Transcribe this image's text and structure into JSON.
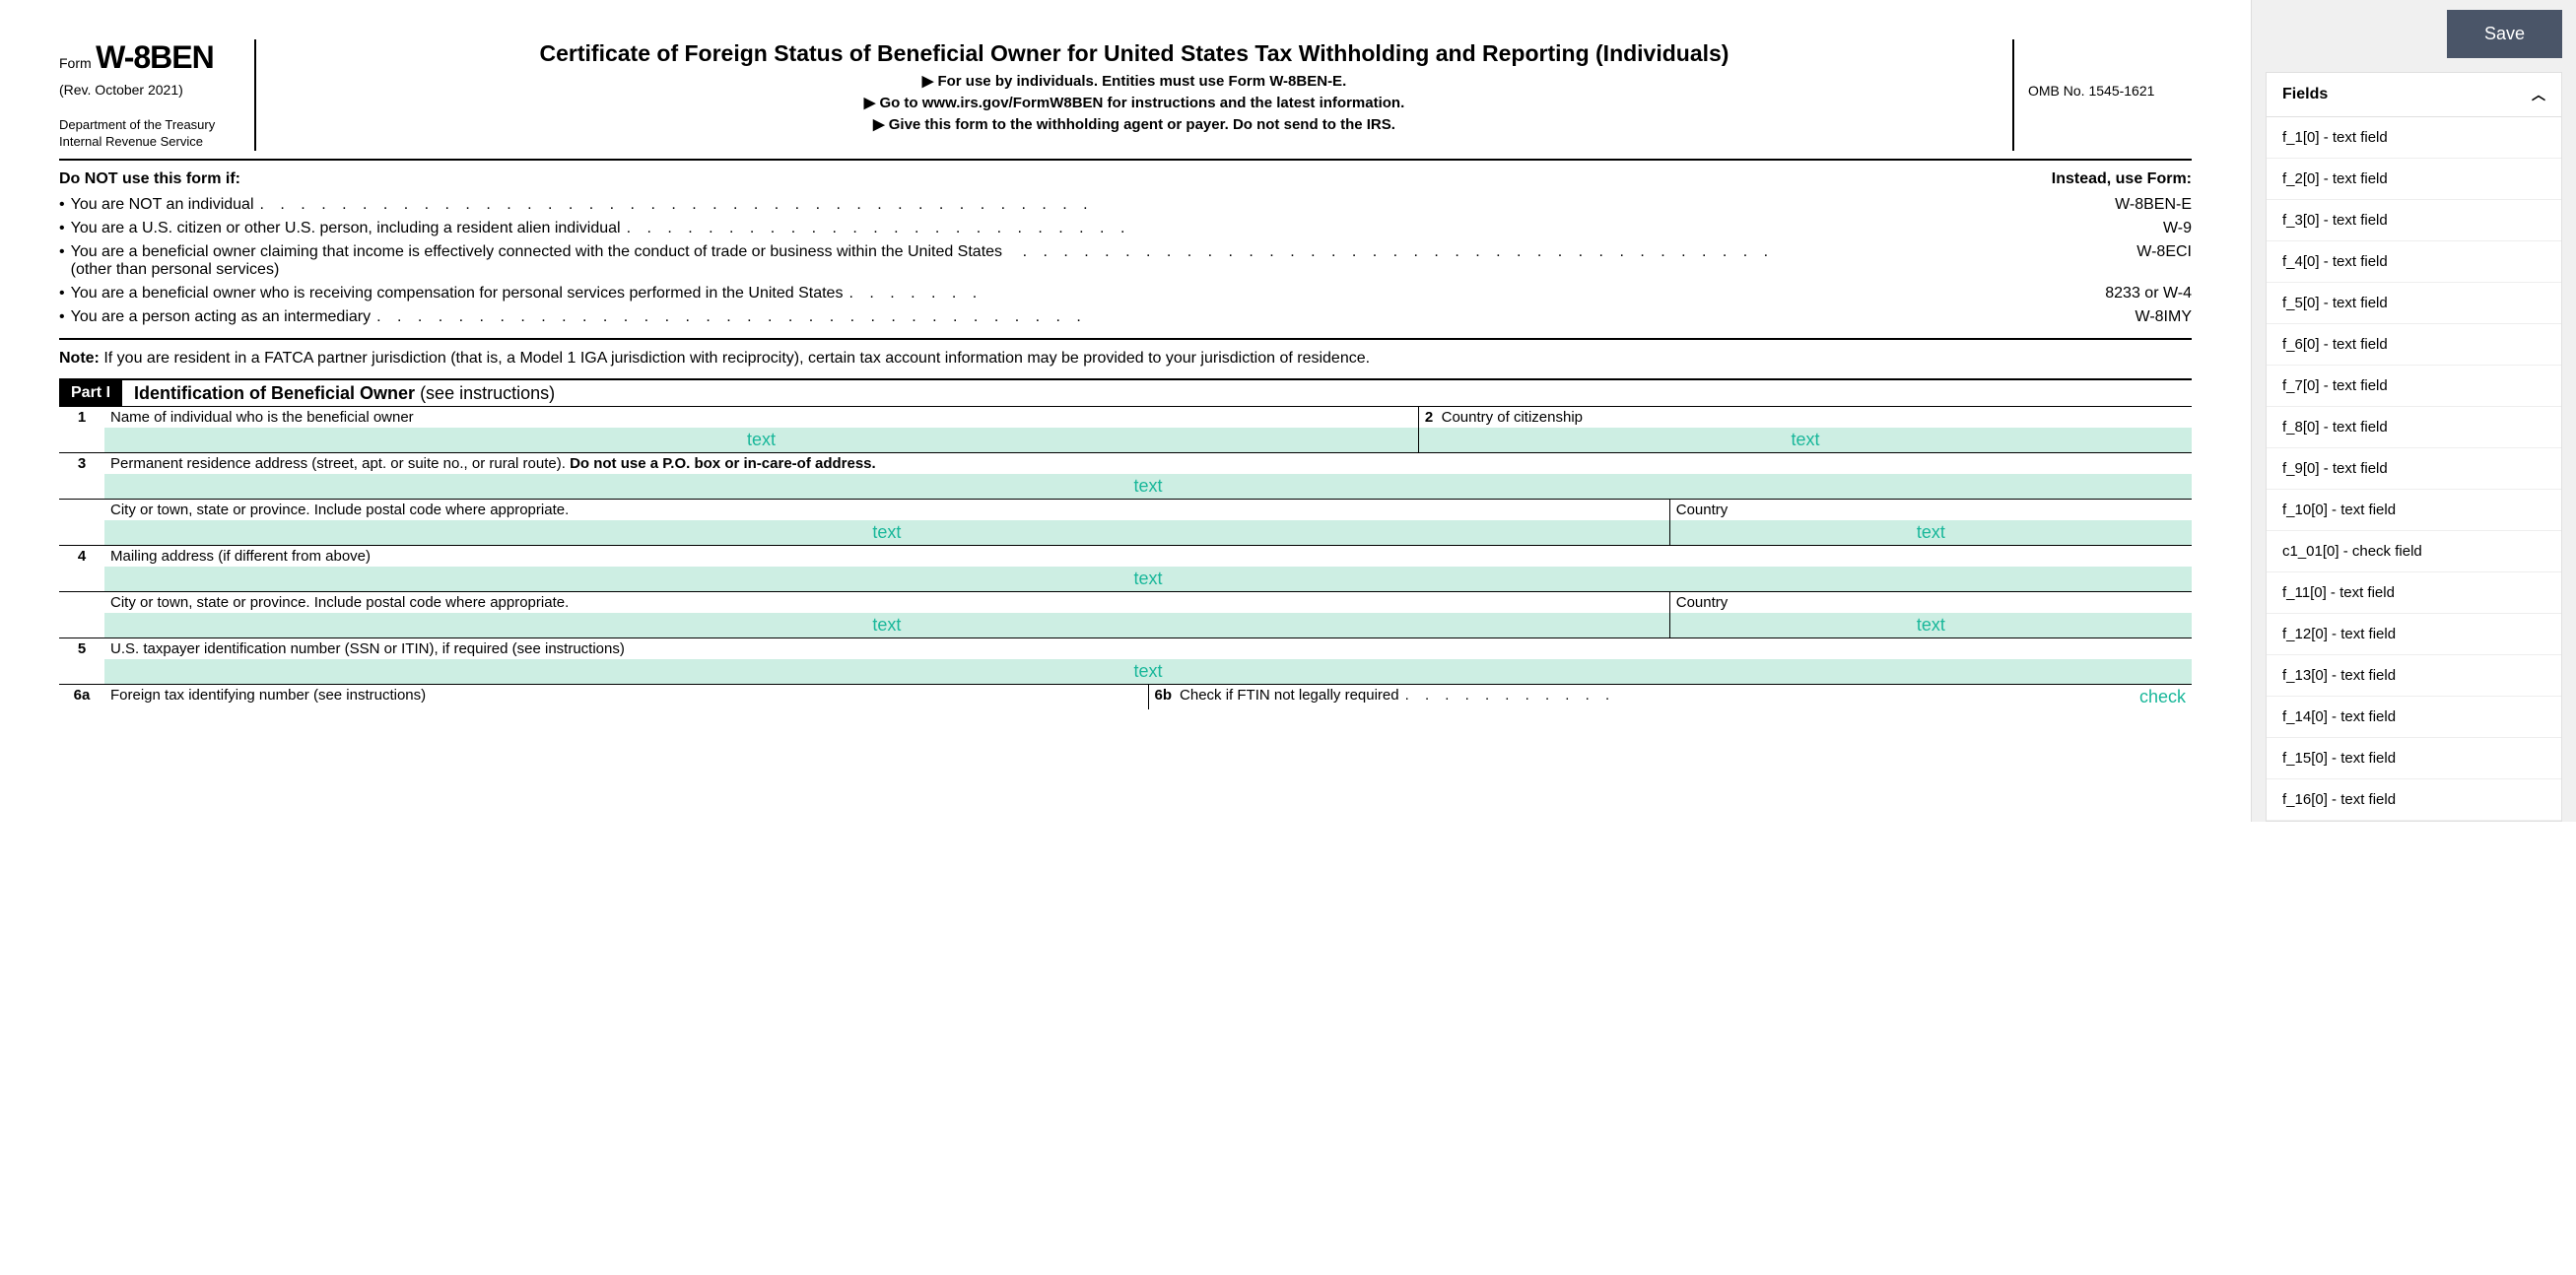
{
  "header": {
    "form_word": "Form",
    "form_code": "W-8BEN",
    "rev": "(Rev. October  2021)",
    "dept1": "Department of the Treasury",
    "dept2": "Internal Revenue Service",
    "title": "Certificate of Foreign Status of Beneficial Owner for United States Tax Withholding and Reporting (Individuals)",
    "instr1": "▶ For use by individuals. Entities must use Form W-8BEN-E.",
    "instr2": "▶ Go to www.irs.gov/FormW8BEN for instructions and the latest information.",
    "instr3": "▶ Give this form to the withholding agent or payer. Do not send to the IRS.",
    "omb": "OMB No. 1545-1621"
  },
  "donot": {
    "left": "Do NOT use this form if:",
    "right": "Instead, use Form:",
    "rows": [
      {
        "txt": "You are NOT an individual",
        "form": "W-8BEN-E"
      },
      {
        "txt": "You are a U.S. citizen or other U.S. person, including a resident alien individual",
        "form": "W-9"
      },
      {
        "txt": "You are a beneficial owner claiming that income is effectively connected with the conduct of trade or business within the United States (other than personal services)",
        "form": "W-8ECI"
      },
      {
        "txt": "You are a beneficial owner who is receiving compensation for personal services performed in the United States",
        "form": "8233 or W-4"
      },
      {
        "txt": "You are a person acting as an intermediary",
        "form": "W-8IMY"
      }
    ],
    "note_label": "Note:",
    "note": " If you are resident in a FATCA partner jurisdiction (that is, a Model 1 IGA jurisdiction with reciprocity), certain tax account information may be provided to your jurisdiction of residence."
  },
  "part1": {
    "badge": "Part I",
    "title_bold": "Identification of Beneficial Owner",
    "title_rest": " (see instructions)"
  },
  "fields": {
    "n1": "1",
    "l1": "Name of individual who is the beneficial owner",
    "n2": "2",
    "l2": "Country of citizenship",
    "n3": "3",
    "l3a": "Permanent residence address (street, apt. or suite no., or rural route). ",
    "l3b": "Do not use a P.O. box or in-care-of address.",
    "l_city": "City or town, state or province. Include postal code where appropriate.",
    "l_country": "Country",
    "n4": "4",
    "l4": "Mailing address (if different from above)",
    "n5": "5",
    "l5": "U.S. taxpayer identification number (SSN or ITIN), if required (see instructions)",
    "n6a": "6a",
    "l6a": "Foreign tax identifying number (see instructions)",
    "n6b": "6b",
    "l6b": "Check if FTIN not legally required",
    "ph": "text",
    "ph_check": "check"
  },
  "sidebar": {
    "save": "Save",
    "fields_title": "Fields",
    "items": [
      "f_1[0] - text field",
      "f_2[0] - text field",
      "f_3[0] - text field",
      "f_4[0] - text field",
      "f_5[0] - text field",
      "f_6[0] - text field",
      "f_7[0] - text field",
      "f_8[0] - text field",
      "f_9[0] - text field",
      "f_10[0] - text field",
      "c1_01[0] - check field",
      "f_11[0] - text field",
      "f_12[0] - text field",
      "f_13[0] - text field",
      "f_14[0] - text field",
      "f_15[0] - text field",
      "f_16[0] - text field"
    ]
  }
}
